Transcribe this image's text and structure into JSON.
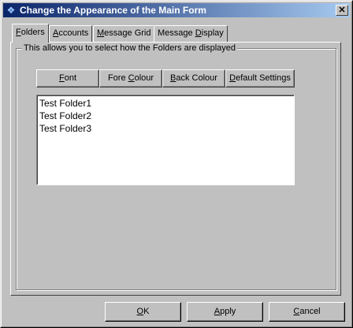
{
  "window": {
    "title": "Change the Appearance of the Main Form",
    "close_glyph": "✕",
    "app_icon": "app-icon"
  },
  "tabs": [
    {
      "pre": "",
      "mn": "F",
      "post": "olders",
      "active": true
    },
    {
      "pre": "",
      "mn": "A",
      "post": "ccounts",
      "active": false
    },
    {
      "pre": "",
      "mn": "M",
      "post": "essage Grid",
      "active": false
    },
    {
      "pre": "Message ",
      "mn": "D",
      "post": "isplay",
      "active": false
    }
  ],
  "group": {
    "label": "This allows you to select how the Folders are displayed"
  },
  "toolbar": [
    {
      "pre": "",
      "mn": "F",
      "post": "ont"
    },
    {
      "pre": "Fore ",
      "mn": "C",
      "post": "olour"
    },
    {
      "pre": "",
      "mn": "B",
      "post": "ack Colour"
    },
    {
      "pre": "",
      "mn": "D",
      "post": "efault Settings"
    }
  ],
  "folders": [
    "Test Folder1",
    "Test Folder2",
    "Test Folder3"
  ],
  "buttons": [
    {
      "pre": "",
      "mn": "O",
      "post": "K"
    },
    {
      "pre": "",
      "mn": "A",
      "post": "pply"
    },
    {
      "pre": "",
      "mn": "C",
      "post": "ancel"
    }
  ]
}
